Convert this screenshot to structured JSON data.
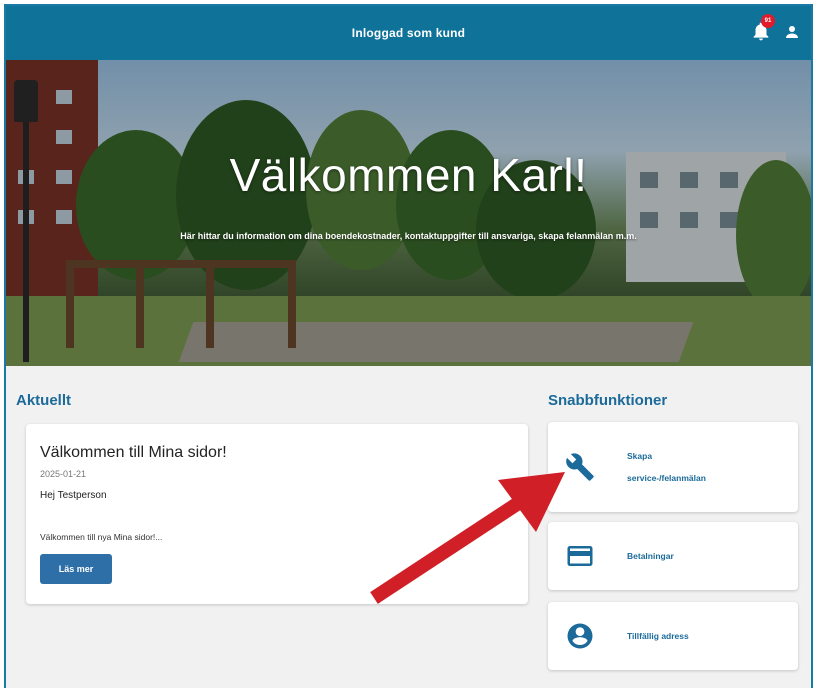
{
  "header": {
    "title": "Inloggad som kund",
    "notification_count": "91",
    "bell_icon": "bell-icon",
    "user_icon": "user-icon",
    "background_color": "#0f7299"
  },
  "hero": {
    "title": "Välkommen Karl!",
    "subtitle": "Här hittar du information om dina boendekostnader, kontaktuppgifter till ansvariga, skapa felanmälan m.m."
  },
  "aktuellt": {
    "heading": "Aktuellt",
    "news": {
      "title": "Välkommen till Mina sidor!",
      "date": "2025-01-21",
      "greeting": "Hej Testperson",
      "body": "Välkommen till nya Mina sidor!...",
      "button_label": "Läs mer"
    }
  },
  "snabbfunktioner": {
    "heading": "Snabbfunktioner",
    "items": [
      {
        "label_line1": "Skapa",
        "label_line2": "service-/felanmälan",
        "icon": "wrench-icon"
      },
      {
        "label": "Betalningar",
        "icon": "credit-card-icon"
      },
      {
        "label": "Tillfällig adress",
        "icon": "account-circle-icon"
      }
    ]
  },
  "colors": {
    "accent": "#1b6a9a",
    "button": "#2f6fa8",
    "badge": "#e21b2a",
    "annotation_arrow": "#d01f26"
  }
}
